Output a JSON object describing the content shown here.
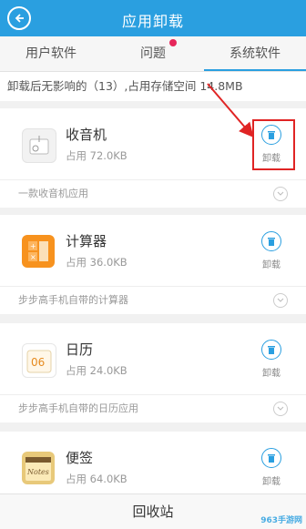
{
  "header": {
    "title": "应用卸载"
  },
  "tabs": [
    {
      "label": "用户软件"
    },
    {
      "label": "问题"
    },
    {
      "label": "系统软件"
    }
  ],
  "summary": {
    "text": "卸载后无影响的（13）,占用存储空间 14.8MB"
  },
  "apps": [
    {
      "name": "收音机",
      "size": "占用 72.0KB",
      "uninstall": "卸载",
      "desc": "一款收音机应用",
      "icon": "radio-icon"
    },
    {
      "name": "计算器",
      "size": "占用 36.0KB",
      "uninstall": "卸载",
      "desc": "步步高手机自带的计算器",
      "icon": "calculator-icon"
    },
    {
      "name": "日历",
      "size": "占用 24.0KB",
      "uninstall": "卸载",
      "desc": "步步高手机自带的日历应用",
      "icon": "calendar-icon",
      "icon_text": "06"
    },
    {
      "name": "便签",
      "size": "占用 64.0KB",
      "uninstall": "卸载",
      "icon": "notes-icon",
      "icon_text": "Notes"
    }
  ],
  "bottom_bar": {
    "label": "回收站"
  },
  "watermark": "963手游网",
  "colors": {
    "accent": "#2a9fe0",
    "highlight": "#e02424",
    "tab_dot": "#e6265a"
  }
}
